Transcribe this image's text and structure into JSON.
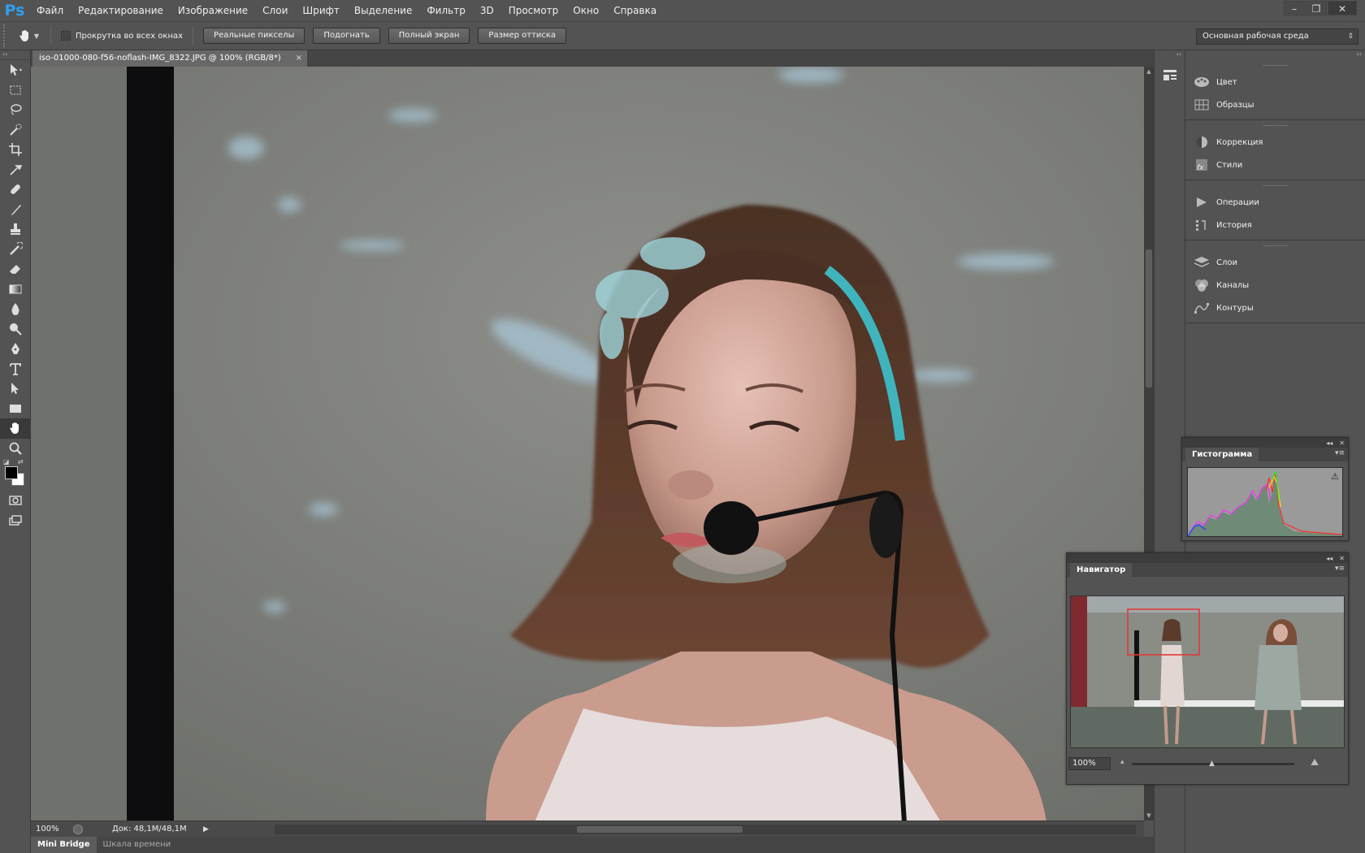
{
  "menubar": {
    "logo": "Ps",
    "items": [
      "Файл",
      "Редактирование",
      "Изображение",
      "Слои",
      "Шрифт",
      "Выделение",
      "Фильтр",
      "3D",
      "Просмотр",
      "Окно",
      "Справка"
    ]
  },
  "options": {
    "scroll_all_label": "Прокрутка во всех окнах",
    "actual_pixels": "Реальные пикселы",
    "fit_screen": "Подогнать",
    "fill_screen": "Полный экран",
    "print_size": "Размер оттиска",
    "workspace": "Основная рабочая среда"
  },
  "document": {
    "tab_title": "iso-01000-080-f56-noflash-IMG_8322.JPG @ 100% (RGB/8*)",
    "close_glyph": "×"
  },
  "status": {
    "zoom": "100%",
    "doc_size": "Док: 48,1M/48,1M"
  },
  "bottom_tabs": [
    "Mini Bridge",
    "Шкала времени"
  ],
  "dock": {
    "groups": [
      [
        {
          "label": "Цвет",
          "icon": "palette-icon"
        },
        {
          "label": "Образцы",
          "icon": "swatches-icon"
        }
      ],
      [
        {
          "label": "Коррекция",
          "icon": "adjustments-icon"
        },
        {
          "label": "Стили",
          "icon": "styles-icon"
        }
      ],
      [
        {
          "label": "Операции",
          "icon": "actions-play-icon"
        },
        {
          "label": "История",
          "icon": "history-icon"
        }
      ],
      [
        {
          "label": "Слои",
          "icon": "layers-icon"
        },
        {
          "label": "Каналы",
          "icon": "channels-icon"
        },
        {
          "label": "Контуры",
          "icon": "paths-icon"
        }
      ]
    ]
  },
  "histogram": {
    "title": "Гистограмма",
    "warning_glyph": "⚠"
  },
  "navigator": {
    "title": "Навигатор",
    "zoom": "100%"
  },
  "colors": {
    "accent_ps": "#2da0f0",
    "foreground": "#000000",
    "background": "#ffffff",
    "nav_frame": "#e23a3a"
  }
}
